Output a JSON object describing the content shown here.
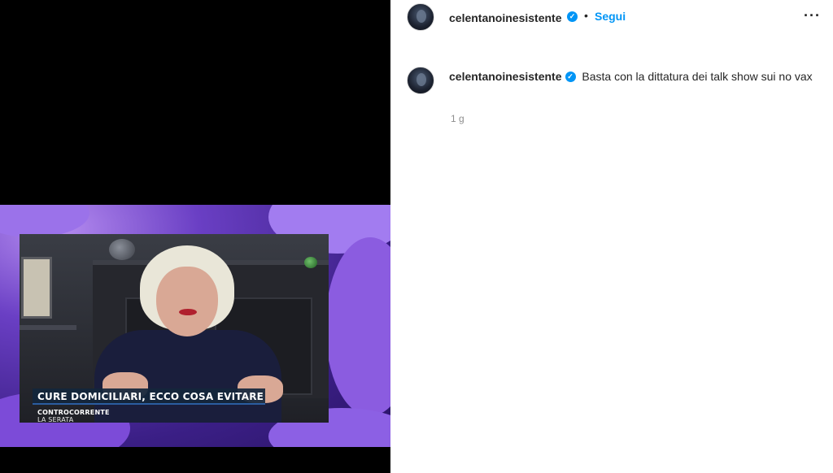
{
  "post": {
    "media": {
      "headline": "CURE DOMICILIARI, ECCO COSA EVITARE",
      "show_logo_main": "CONTROCORRENTE",
      "show_logo_sub": "LA SERATA"
    },
    "header": {
      "username": "celentanoinesistente",
      "separator": "•",
      "follow_label": "Segui",
      "more_label": "···"
    },
    "caption": {
      "username": "celentanoinesistente",
      "text": "Basta con la dittatura dei talk show sui no vax",
      "timestamp": "1 g"
    },
    "verified_glyph": "✓"
  },
  "colors": {
    "accent": "#0095f6",
    "frame_purple": "#6a3fc4",
    "banner_blue": "#14263c"
  }
}
